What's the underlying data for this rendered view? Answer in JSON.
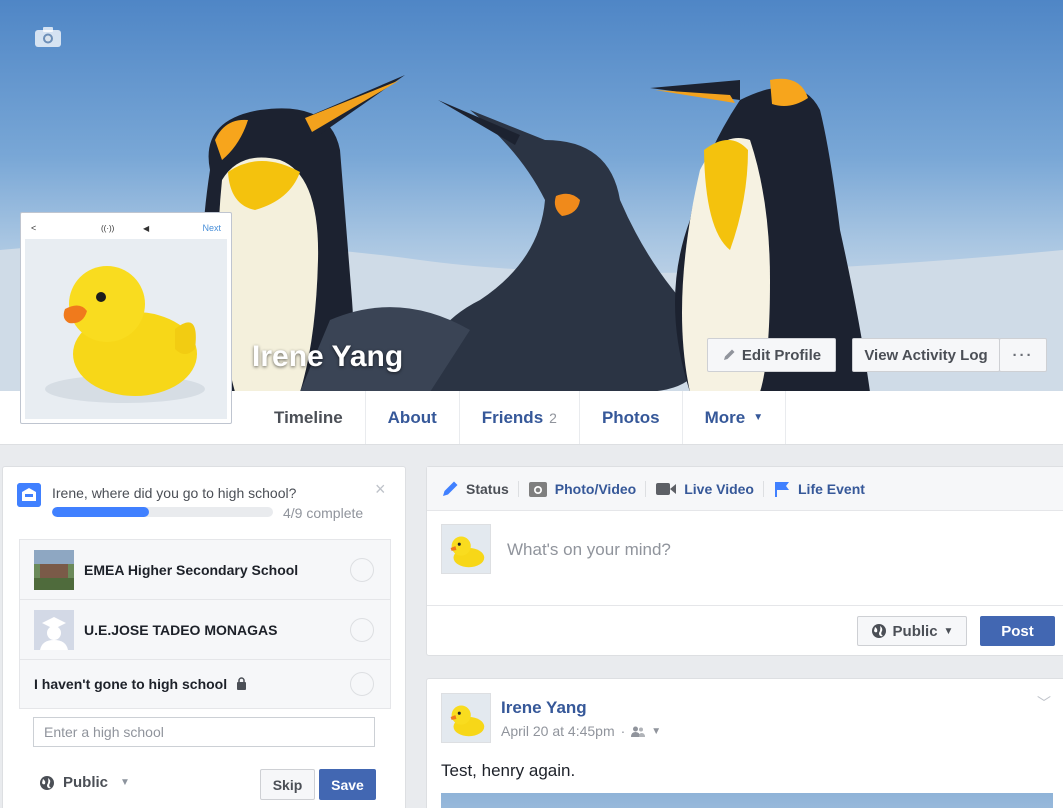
{
  "profile": {
    "name": "Irene Yang",
    "cover_photo": "penguins",
    "profile_photo_bar": {
      "back": "<",
      "next": "Next"
    }
  },
  "header_buttons": {
    "edit_profile": "Edit Profile",
    "view_activity_log": "View Activity Log",
    "more": "···"
  },
  "nav": {
    "tabs": [
      {
        "label": "Timeline",
        "active": true
      },
      {
        "label": "About"
      },
      {
        "label": "Friends",
        "count": "2"
      },
      {
        "label": "Photos"
      },
      {
        "label": "More",
        "caret": "▼"
      }
    ]
  },
  "school_prompt": {
    "question": "Irene, where did you go to high school?",
    "close": "×",
    "progress": 0.44,
    "progress_text": "4/9 complete",
    "options": [
      {
        "label": "EMEA Higher Secondary School"
      },
      {
        "label": "U.E.JOSE TADEO MONAGAS"
      },
      {
        "label": "I haven't gone to high school"
      }
    ],
    "input_placeholder": "Enter a high school",
    "audience": "Public",
    "skip": "Skip",
    "save": "Save"
  },
  "composer": {
    "tabs": [
      {
        "label": "Status",
        "icon": "pencil-icon",
        "active": true
      },
      {
        "label": "Photo/Video",
        "icon": "camera-icon"
      },
      {
        "label": "Live Video",
        "icon": "video-icon"
      },
      {
        "label": "Life Event",
        "icon": "flag-icon"
      }
    ],
    "placeholder": "What's on your mind?",
    "audience": "Public",
    "post": "Post"
  },
  "post": {
    "author": "Irene Yang",
    "timestamp": "April 20 at 4:45pm",
    "separator": "·",
    "text": "Test, henry again."
  },
  "colors": {
    "brand_blue": "#4267b2",
    "link_blue": "#365899",
    "accent_blue": "#4080ff",
    "page_bg": "#e9ebee"
  }
}
